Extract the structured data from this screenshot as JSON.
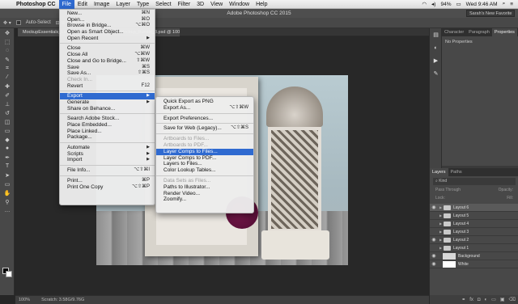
{
  "menubar": {
    "apple": "",
    "app": "Photoshop CC",
    "items": [
      "File",
      "Edit",
      "Image",
      "Layer",
      "Type",
      "Select",
      "Filter",
      "3D",
      "View",
      "Window",
      "Help"
    ],
    "battery": "94%",
    "clock": "Wed 9:46 AM"
  },
  "title": "Adobe Photoshop CC 2015",
  "workspace": "Sarah's New Favorite",
  "options": {
    "auto_select": "Auto-Select"
  },
  "document_tab": "MockupEssentials_Lantern_and_Picture_Frame_Mockup_Bundle_8.psd @ 100% (Layout 6, RGB/8#)",
  "file_menu": [
    {
      "label": "New...",
      "shortcut": "⌘N"
    },
    {
      "label": "Open...",
      "shortcut": "⌘O"
    },
    {
      "label": "Browse in Bridge...",
      "shortcut": "⌥⌘O"
    },
    {
      "label": "Open as Smart Object...",
      "shortcut": ""
    },
    {
      "label": "Open Recent",
      "shortcut": "▶"
    },
    {
      "sep": true
    },
    {
      "label": "Close",
      "shortcut": "⌘W"
    },
    {
      "label": "Close All",
      "shortcut": "⌥⌘W"
    },
    {
      "label": "Close and Go to Bridge...",
      "shortcut": "⇧⌘W"
    },
    {
      "label": "Save",
      "shortcut": "⌘S"
    },
    {
      "label": "Save As...",
      "shortcut": "⇧⌘S"
    },
    {
      "label": "Check In...",
      "shortcut": "",
      "disabled": true
    },
    {
      "label": "Revert",
      "shortcut": "F12"
    },
    {
      "sep": true
    },
    {
      "label": "Export",
      "shortcut": "▶",
      "highlight": true
    },
    {
      "label": "Generate",
      "shortcut": "▶"
    },
    {
      "label": "Share on Behance...",
      "shortcut": ""
    },
    {
      "sep": true
    },
    {
      "label": "Search Adobe Stock...",
      "shortcut": ""
    },
    {
      "label": "Place Embedded...",
      "shortcut": ""
    },
    {
      "label": "Place Linked...",
      "shortcut": ""
    },
    {
      "label": "Package...",
      "shortcut": ""
    },
    {
      "sep": true
    },
    {
      "label": "Automate",
      "shortcut": "▶"
    },
    {
      "label": "Scripts",
      "shortcut": "▶"
    },
    {
      "label": "Import",
      "shortcut": "▶"
    },
    {
      "sep": true
    },
    {
      "label": "File Info...",
      "shortcut": "⌥⇧⌘I"
    },
    {
      "sep": true
    },
    {
      "label": "Print...",
      "shortcut": "⌘P"
    },
    {
      "label": "Print One Copy",
      "shortcut": "⌥⇧⌘P"
    }
  ],
  "export_menu": [
    {
      "label": "Quick Export as PNG",
      "shortcut": ""
    },
    {
      "label": "Export As...",
      "shortcut": "⌥⇧⌘W"
    },
    {
      "sep": true
    },
    {
      "label": "Export Preferences...",
      "shortcut": ""
    },
    {
      "sep": true
    },
    {
      "label": "Save for Web (Legacy)...",
      "shortcut": "⌥⇧⌘S"
    },
    {
      "sep": true
    },
    {
      "label": "Artboards to Files...",
      "shortcut": "",
      "disabled": true
    },
    {
      "label": "Artboards to PDF...",
      "shortcut": "",
      "disabled": true
    },
    {
      "label": "Layer Comps to Files...",
      "shortcut": "",
      "highlight": true
    },
    {
      "label": "Layer Comps to PDF...",
      "shortcut": ""
    },
    {
      "label": "Layers to Files...",
      "shortcut": ""
    },
    {
      "label": "Color Lookup Tables...",
      "shortcut": ""
    },
    {
      "sep": true
    },
    {
      "label": "Data Sets as Files...",
      "shortcut": "",
      "disabled": true
    },
    {
      "label": "Paths to Illustrator...",
      "shortcut": ""
    },
    {
      "label": "Render Video...",
      "shortcut": ""
    },
    {
      "label": "Zoomify...",
      "shortcut": ""
    }
  ],
  "panels": {
    "top_tabs": [
      "Character",
      "Paragraph",
      "Properties"
    ],
    "no_properties": "No Properties",
    "layer_tabs": [
      "Layers",
      "Paths"
    ],
    "filter_kind": "Kind",
    "blend_mode": "Pass Through",
    "opacity_label": "Opacity:",
    "lock_label": "Lock:",
    "fill_label": "Fill:"
  },
  "layers": [
    {
      "name": "Layout 6",
      "type": "folder",
      "visible": true,
      "selected": true
    },
    {
      "name": "Layout 5",
      "type": "folder",
      "visible": false
    },
    {
      "name": "Layout 4",
      "type": "folder",
      "visible": false
    },
    {
      "name": "Layout 3",
      "type": "folder",
      "visible": false
    },
    {
      "name": "Layout 2",
      "type": "folder",
      "visible": true
    },
    {
      "name": "Layout 1",
      "type": "folder",
      "visible": false
    },
    {
      "name": "Background",
      "type": "image",
      "visible": true
    },
    {
      "name": "White",
      "type": "white",
      "visible": true
    }
  ],
  "status": {
    "zoom": "100%",
    "doc": "Scratch: 3.58G/9.76G"
  }
}
